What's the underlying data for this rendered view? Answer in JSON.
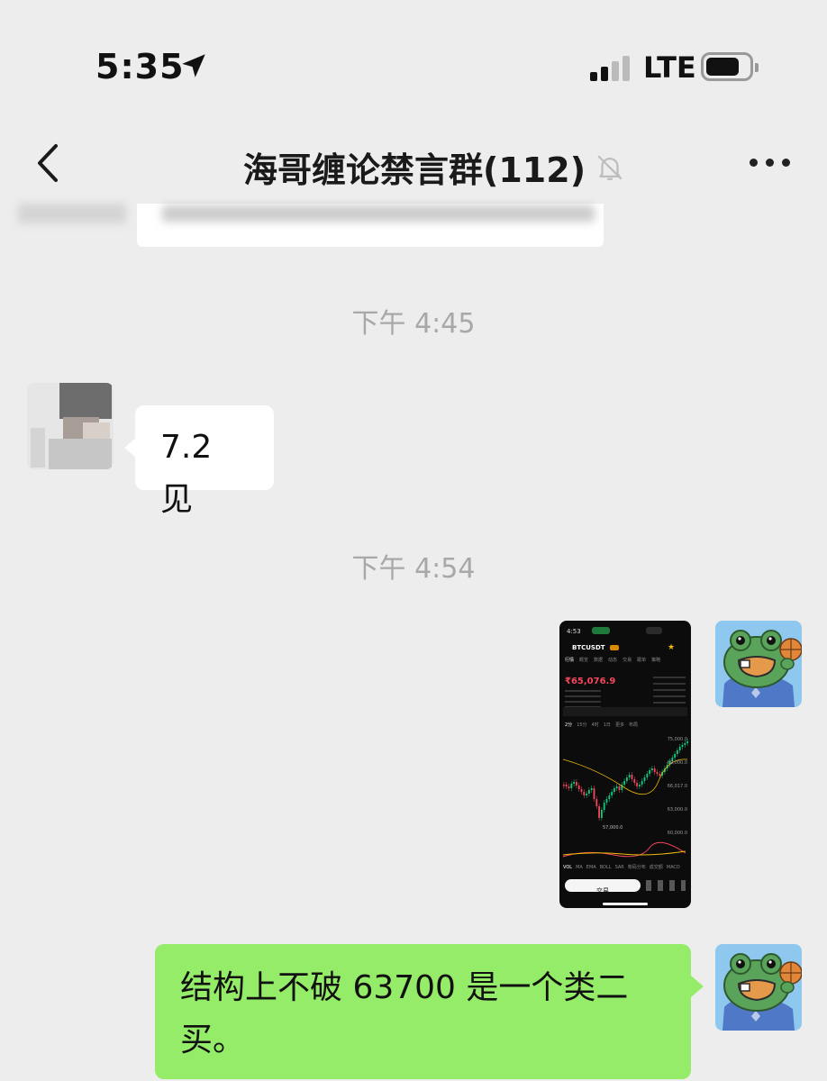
{
  "status_bar": {
    "time": "5:35",
    "network": "LTE"
  },
  "header": {
    "title": "海哥缠论禁言群(112)"
  },
  "messages": {
    "ts1": "下午 4:45",
    "msg1": "7.2 见",
    "ts2": "下午 4:54",
    "msg3": "结构上不破 63700 是一个类二买。"
  },
  "screenshot": {
    "time": "4:53",
    "pair": "BTCUSDT",
    "price": "₹65,076.9",
    "tabs": [
      "行情",
      "概览",
      "数据",
      "动态",
      "交易",
      "跟单",
      "策略"
    ],
    "intervals": [
      "2分",
      "15分",
      "4时",
      "1日",
      "更多",
      "布局"
    ],
    "levels": [
      "75,000.0",
      "69,000.0",
      "66,017.0",
      "63,000.0",
      "60,000.0"
    ],
    "low_label": "57,000.0",
    "trade_button": "交易",
    "indicators": [
      "VOL",
      "MA",
      "EMA",
      "BOLL",
      "SAR",
      "筹码分布",
      "成交额",
      "MACD"
    ]
  },
  "colors": {
    "bubble_out": "#95ec69",
    "bubble_in": "#ffffff",
    "background": "#ededed",
    "timestamp": "#a8a8a8"
  },
  "icons": [
    "location-arrow-icon",
    "signal-bars-icon",
    "battery-icon",
    "back-chevron-icon",
    "mute-bell-icon",
    "more-dots-icon"
  ]
}
